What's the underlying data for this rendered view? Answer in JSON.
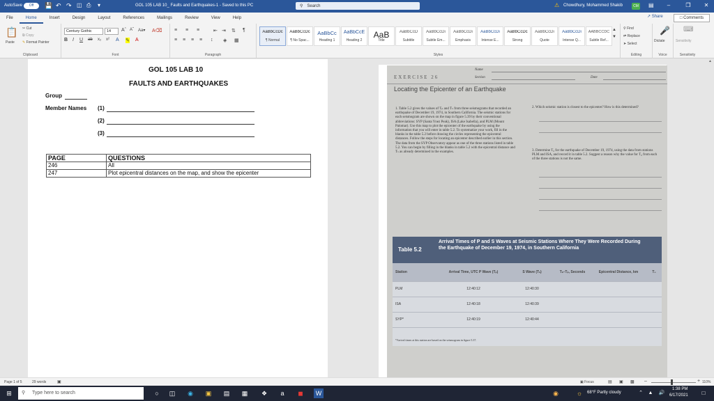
{
  "titlebar": {
    "autosave_label": "AutoSave",
    "autosave_state": "Off",
    "doc_title": "GOL 105 LAB 10_ Faults and Earthquakes-1  -  Saved to this PC",
    "search_placeholder": "Search",
    "user_name": "Chowdhury, Mohammed Shakib",
    "user_initials": "CM"
  },
  "tabs": [
    "File",
    "Home",
    "Insert",
    "Design",
    "Layout",
    "References",
    "Mailings",
    "Review",
    "View",
    "Help"
  ],
  "share_label": "Share",
  "comments_label": "Comments",
  "ribbon": {
    "clipboard": {
      "paste": "Paste",
      "cut": "Cut",
      "copy": "Copy",
      "format_painter": "Format Painter",
      "label": "Clipboard"
    },
    "font": {
      "name": "Century Gothic",
      "size": "14",
      "label": "Font"
    },
    "paragraph_label": "Paragraph",
    "styles_label": "Styles",
    "styles": [
      {
        "sample": "AaBbCcDc",
        "name": "¶ Normal"
      },
      {
        "sample": "AaBbCcDc",
        "name": "¶ No Spac..."
      },
      {
        "sample": "AaBbCc",
        "name": "Heading 1"
      },
      {
        "sample": "AaBbCcE",
        "name": "Heading 2"
      },
      {
        "sample": "AaB",
        "name": "Title"
      },
      {
        "sample": "AaBbCcD",
        "name": "Subtitle"
      },
      {
        "sample": "AaBbCcDi",
        "name": "Subtle Em..."
      },
      {
        "sample": "AaBbCcDi",
        "name": "Emphasis"
      },
      {
        "sample": "AaBbCcDi",
        "name": "Intense E..."
      },
      {
        "sample": "AaBbCcDc",
        "name": "Strong"
      },
      {
        "sample": "AaBbCcDi",
        "name": "Quote"
      },
      {
        "sample": "AaBbCcDi",
        "name": "Intense Q..."
      },
      {
        "sample": "AABBCCDC",
        "name": "Subtle Ref..."
      }
    ],
    "editing": {
      "find": "Find",
      "replace": "Replace",
      "select": "Select",
      "label": "Editing"
    },
    "voice": {
      "dictate": "Dictate",
      "label": "Voice"
    },
    "sensitivity": {
      "name": "Sensitivity",
      "label": "Sensitivity"
    }
  },
  "doc": {
    "title": "GOL 105 LAB 10",
    "subtitle": "FAULTS AND EARTHQUAKES",
    "group_label": "Group",
    "member_label": "Member Names",
    "member_nums": [
      "(1)",
      "(2)",
      "(3)"
    ],
    "table": {
      "headers": [
        "PAGE",
        "QUESTIONS"
      ],
      "rows": [
        [
          "246",
          "All"
        ],
        [
          "247",
          "Plot epicentral distances on the map, and show the epicenter"
        ]
      ]
    }
  },
  "photo": {
    "name_label": "Name",
    "section_label": "Section",
    "date_label": "Date",
    "exercise": "EXERCISE 26",
    "heading": "Locating the Epicenter of an Earthquake",
    "q1": "1. Table 5.2 gives the values of Tₚ and Tₛ from three seismograms that recorded an earthquake of December 19, 1974, in Southern California. The seismic stations for each seismogram are shown on the map in figure 5.39 by their conventional abbreviations: SYP (Santa Ynez Peak), ISA (Lake Isabella), and PLM (Mount Palomar). Use this map to plot the epicenter of the earthquake by using the information that you will enter in table 5.2. To systematize your work, fill in the blanks in the table 5.2 before drawing the circles representing the epicentral distances. Follow the steps for locating an epicenter described earlier in this section. The data from the SYP Observatory appear as one of the three stations listed in table 5.2. You can begin by filling in the blanks in table 5.2 with the epicentral distance and Tₛ as already determined in the examples.",
    "q2": "2. Which seismic station is closest to the epicenter? How is this determined?",
    "q3": "3. Determine T₀ for the earthquake of December 19, 1974, using the data from stations PLM and ISA, and record it in table 5.2. Suggest a reason why the value for T₀ from each of the three stations is not the same.",
    "table_num": "Table 5.2",
    "table_title": "Arrival Times of P and S Waves at Seismic Stations Where They Were Recorded During the Earthquake of December 19, 1974, in Southern California",
    "columns": [
      "Station",
      "Arrival Time, UTC P Wave (Tₚ)",
      "S Wave (Tₛ)",
      "Tₛ–Tₚ, Seconds",
      "Epicentral Distance, km",
      "T₀"
    ],
    "rows": [
      [
        "PLM",
        "12:40:12",
        "12:40:30"
      ],
      [
        "ISA",
        "12:40:18",
        "12:40:39"
      ],
      [
        "SYP*",
        "12:40:19",
        "12:40:44"
      ]
    ],
    "footnote": "*Arrival times at this station are based on the seismogram in figure 5.37."
  },
  "statusbar": {
    "page": "Page 1 of 5",
    "words": "29 words",
    "focus": "Focus",
    "zoom": "110%"
  },
  "taskbar": {
    "search_placeholder": "Type here to search",
    "weather": "68°F  Partly cloudy",
    "time": "1:38 PM",
    "date": "6/17/2021"
  },
  "colors": {
    "accent": "#2b579a",
    "taskbar": "#1f2535",
    "table_header": "#4f5f7a"
  }
}
